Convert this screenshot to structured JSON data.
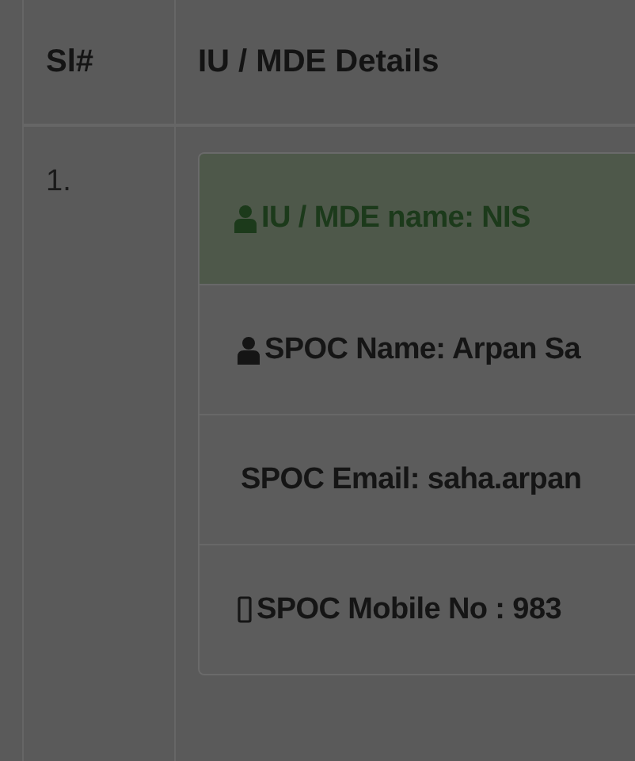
{
  "table": {
    "columns": [
      "Sl#",
      "IU / MDE Details"
    ],
    "rows": [
      {
        "serial": "1.",
        "card": {
          "heading": {
            "kind": "person",
            "text": "IU / MDE name: NIS"
          },
          "items": [
            {
              "kind": "person",
              "text": "SPOC Name: Arpan Sa"
            },
            {
              "kind": "plain",
              "text": "SPOC Email: saha.arpan"
            },
            {
              "kind": "mobile",
              "text": "SPOC Mobile No : 983"
            }
          ]
        }
      }
    ]
  }
}
